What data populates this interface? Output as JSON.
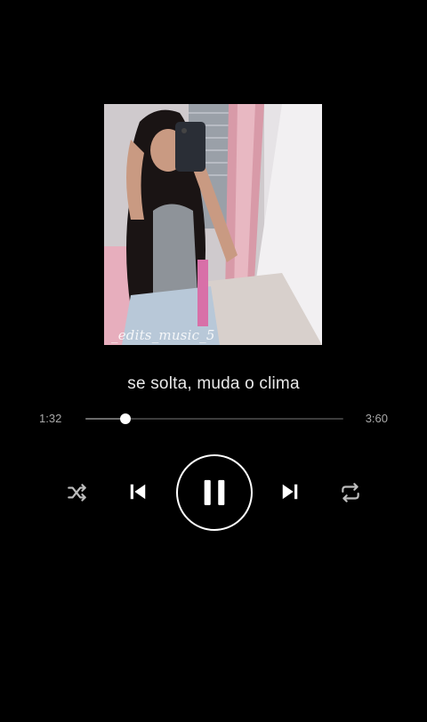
{
  "player": {
    "album_art": {
      "watermark": "_edits_music_5"
    },
    "lyric": "se solta, muda o clima",
    "progress": {
      "elapsed": "1:32",
      "total": "3:60",
      "fraction": 0.156
    },
    "controls": {
      "shuffle": "shuffle-icon",
      "previous": "skip-previous-icon",
      "play_pause": "pause-icon",
      "next": "skip-next-icon",
      "repeat": "repeat-icon"
    },
    "colors": {
      "background": "#000000",
      "text": "#ffffff",
      "muted_text": "#a9a9a9",
      "track": "#3c3c3c"
    }
  }
}
